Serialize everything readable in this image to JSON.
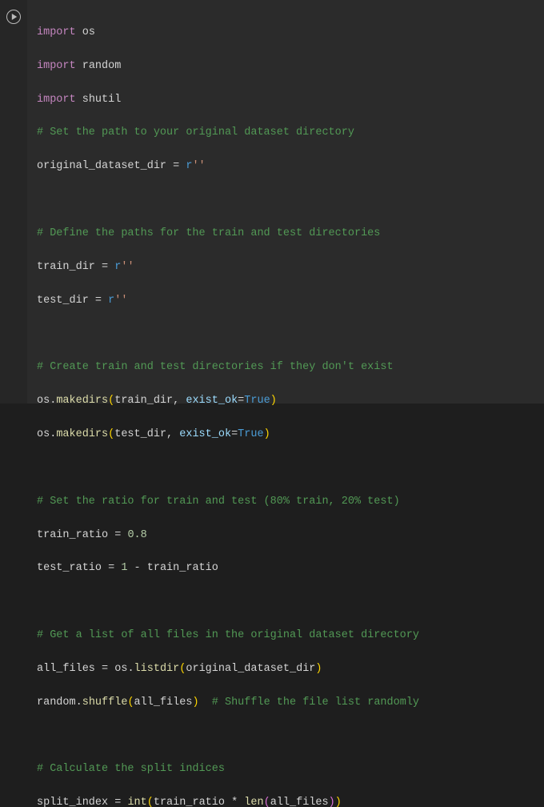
{
  "gutter": {
    "run_title": "Run cell"
  },
  "code": {
    "l1": {
      "import": "import",
      "mod": "os"
    },
    "l2": {
      "import": "import",
      "mod": "random"
    },
    "l3": {
      "import": "import",
      "mod": "shutil"
    },
    "l4": {
      "comment": "# Set the path to your original dataset directory"
    },
    "l5": {
      "var": "original_dataset_dir",
      "eq": " = ",
      "prefix": "r",
      "str": "''"
    },
    "l7": {
      "comment": "# Define the paths for the train and test directories"
    },
    "l8": {
      "var": "train_dir",
      "eq": " = ",
      "prefix": "r",
      "str": "''"
    },
    "l9": {
      "var": "test_dir",
      "eq": " = ",
      "prefix": "r",
      "str": "''"
    },
    "l11": {
      "comment": "# Create train and test directories if they don't exist"
    },
    "l12": {
      "obj": "os",
      "dot": ".",
      "fn": "makedirs",
      "po": "(",
      "a1": "train_dir",
      "c1": ", ",
      "kw": "exist_ok",
      "eq": "=",
      "val": "True",
      "pc": ")"
    },
    "l13": {
      "obj": "os",
      "dot": ".",
      "fn": "makedirs",
      "po": "(",
      "a1": "test_dir",
      "c1": ", ",
      "kw": "exist_ok",
      "eq": "=",
      "val": "True",
      "pc": ")"
    },
    "l15": {
      "comment": "# Set the ratio for train and test (80% train, 20% test)"
    },
    "l16": {
      "var": "train_ratio",
      "eq": " = ",
      "num": "0.8"
    },
    "l17": {
      "var": "test_ratio",
      "eq": " = ",
      "num": "1",
      "op": " - ",
      "var2": "train_ratio"
    },
    "l19": {
      "comment": "# Get a list of all files in the original dataset directory"
    },
    "l20": {
      "var": "all_files",
      "eq": " = ",
      "obj": "os",
      "dot": ".",
      "fn": "listdir",
      "po": "(",
      "a1": "original_dataset_dir",
      "pc": ")"
    },
    "l21": {
      "obj": "random",
      "dot": ".",
      "fn": "shuffle",
      "po": "(",
      "a1": "all_files",
      "pc": ")",
      "sp": "  ",
      "comment": "# Shuffle the file list randomly"
    },
    "l23": {
      "comment": "# Calculate the split indices"
    },
    "l24": {
      "var": "split_index",
      "eq": " = ",
      "fn": "int",
      "po": "(",
      "a1": "train_ratio",
      "op": " * ",
      "fn2": "len",
      "po2": "(",
      "a2": "all_files",
      "pc2": ")",
      "pc": ")"
    }
  }
}
